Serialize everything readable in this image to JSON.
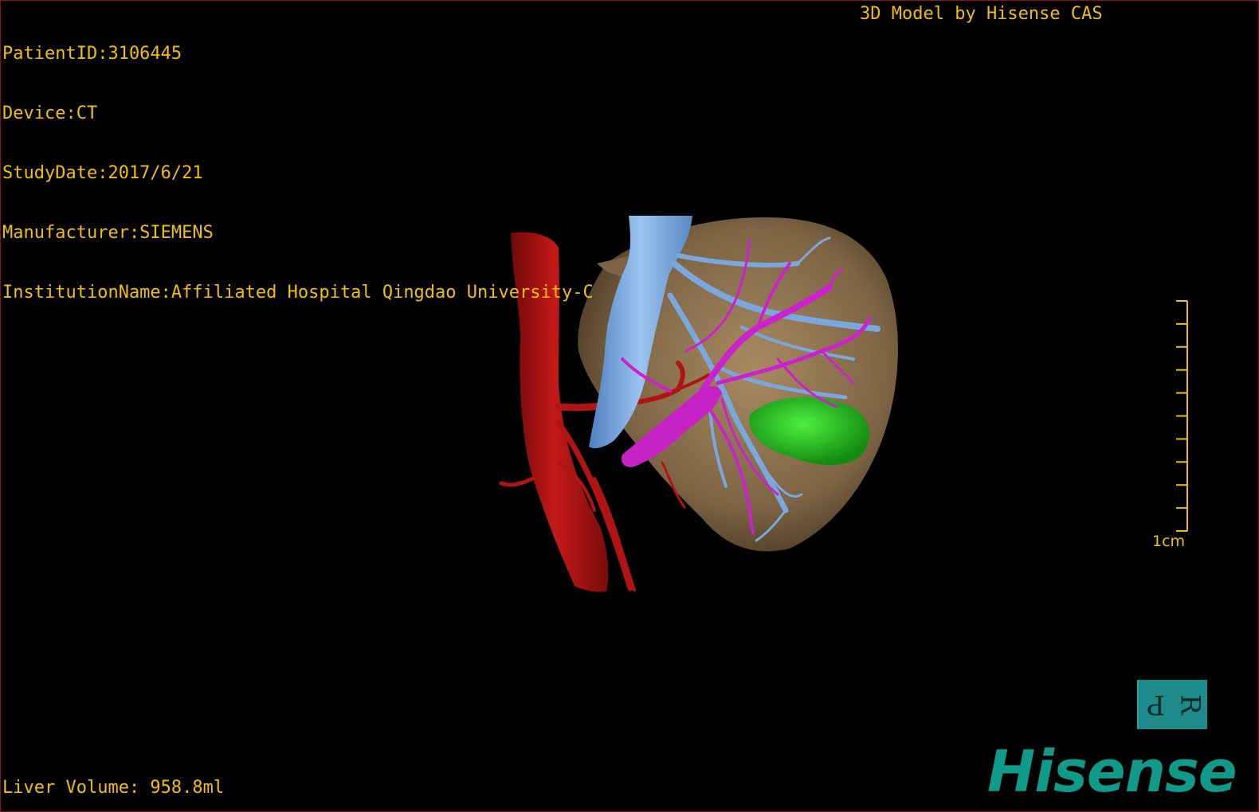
{
  "info": {
    "patient_id": "PatientID:3106445",
    "device": "Device:CT",
    "study_date": "StudyDate:2017/6/21",
    "manufacturer": "Manufacturer:SIEMENS",
    "institution": "InstitutionName:Affiliated Hospital Qingdao University-C"
  },
  "credit": "3D Model by Hisense CAS",
  "liver_volume": "Liver Volume: 958.8ml",
  "scale": {
    "label": "1cm",
    "tick_count": 10
  },
  "orientation_cube": {
    "left": "P",
    "right": "R"
  },
  "brand_logo": "Hisense",
  "colors": {
    "overlay_text": "#f0c000",
    "liver": "#8a7150",
    "artery": "#b01414",
    "hepatic_vein": "#6e9fd8",
    "portal_vein": "#cc22cc",
    "lesion": "#22c020",
    "brand": "#0f9a8a"
  }
}
